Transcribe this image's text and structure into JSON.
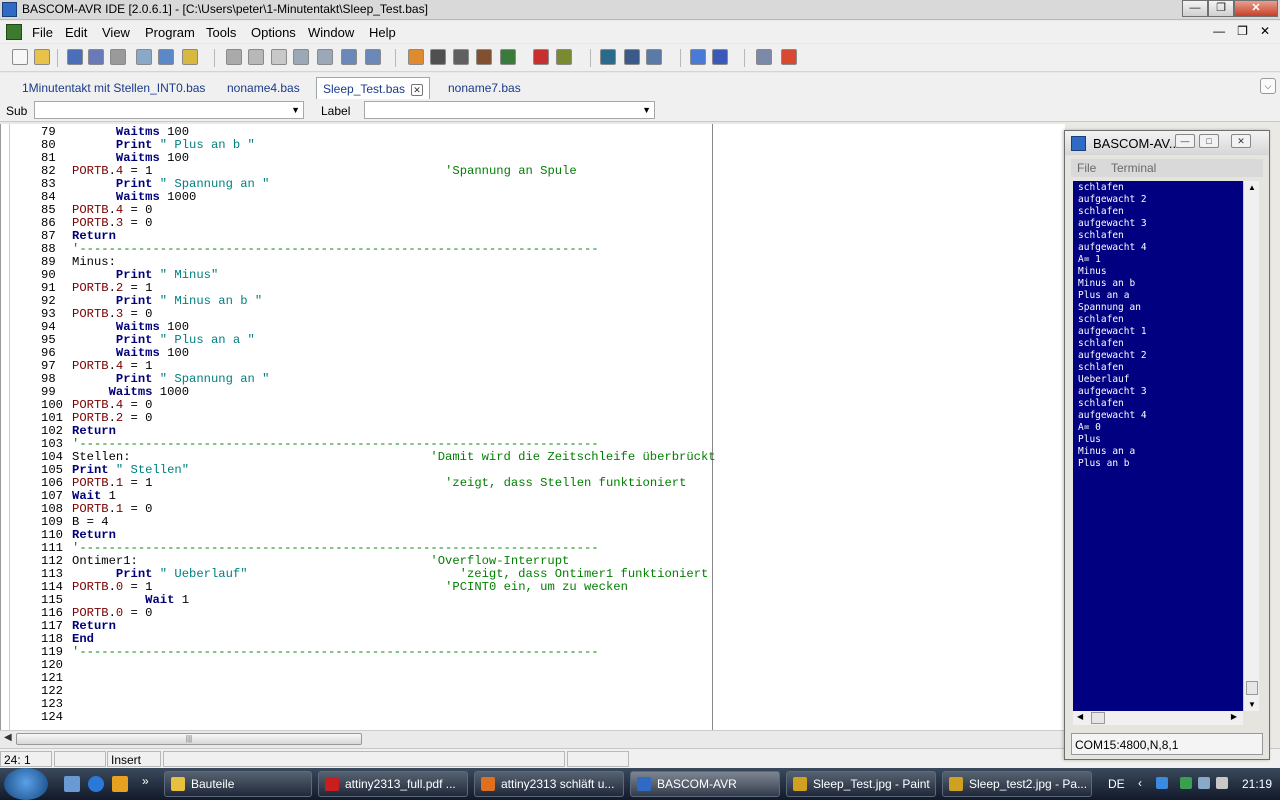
{
  "window": {
    "title": "BASCOM-AVR IDE [2.0.6.1] - [C:\\Users\\peter\\1-Minutentakt\\Sleep_Test.bas]"
  },
  "menu": [
    "File",
    "Edit",
    "View",
    "Program",
    "Tools",
    "Options",
    "Window",
    "Help"
  ],
  "toolbar": {
    "icons": [
      "new-file-icon",
      "open-file-icon",
      "save-icon",
      "save-all-icon",
      "print-icon",
      "print-preview-icon",
      "find-icon",
      "save-copy-icon",
      "cut-icon",
      "copy-icon",
      "paste-icon",
      "indent-icon",
      "unindent-icon",
      "find-text-icon",
      "replace-icon",
      "compile-icon",
      "syntax-check-icon",
      "chip-icon",
      "chip2-icon",
      "programmer-icon",
      "stop-icon",
      "lcd-icon",
      "simulator-icon",
      "terminal-icon",
      "wave-icon",
      "info-icon",
      "help-icon",
      "zoom-icon",
      "pdf-icon"
    ]
  },
  "tabs": [
    {
      "label": "1Minutentakt mit Stellen_INT0.bas",
      "active": false
    },
    {
      "label": "noname4.bas",
      "active": false
    },
    {
      "label": "Sleep_Test.bas",
      "active": true
    },
    {
      "label": "noname7.bas",
      "active": false
    }
  ],
  "combobar": {
    "sub_label": "Sub",
    "sub_value": "",
    "label_label": "Label",
    "label_value": ""
  },
  "code": [
    {
      "n": "79",
      "t": [
        [
          "i",
          "      "
        ],
        [
          "k",
          "Waitms"
        ],
        [
          "n",
          " 100"
        ]
      ]
    },
    {
      "n": "80",
      "t": [
        [
          "i",
          "      "
        ],
        [
          "k",
          "Print"
        ],
        [
          "s",
          " \" Plus an b \""
        ]
      ]
    },
    {
      "n": "81",
      "t": [
        [
          "i",
          "      "
        ],
        [
          "k",
          "Waitms"
        ],
        [
          "n",
          " 100"
        ]
      ]
    },
    {
      "n": "82",
      "t": [
        [
          "p",
          "PORTB"
        ],
        [
          "n",
          "."
        ],
        [
          "p",
          "4"
        ],
        [
          "n",
          " = 1"
        ],
        [
          "pad",
          "                                        "
        ],
        [
          "c",
          "'Spannung an Spule"
        ]
      ]
    },
    {
      "n": "83",
      "t": [
        [
          "i",
          "      "
        ],
        [
          "k",
          "Print"
        ],
        [
          "s",
          " \" Spannung an \""
        ]
      ]
    },
    {
      "n": "84",
      "t": [
        [
          "i",
          "      "
        ],
        [
          "k",
          "Waitms"
        ],
        [
          "n",
          " 1000"
        ]
      ]
    },
    {
      "n": "85",
      "t": [
        [
          "p",
          "PORTB"
        ],
        [
          "n",
          "."
        ],
        [
          "p",
          "4"
        ],
        [
          "n",
          " = 0"
        ]
      ]
    },
    {
      "n": "86",
      "t": [
        [
          "p",
          "PORTB"
        ],
        [
          "n",
          "."
        ],
        [
          "p",
          "3"
        ],
        [
          "n",
          " = 0"
        ]
      ]
    },
    {
      "n": "87",
      "t": [
        [
          "k",
          "Return"
        ]
      ]
    },
    {
      "n": "88",
      "t": [
        [
          "c",
          "'-----------------------------------------------------------------------"
        ]
      ]
    },
    {
      "n": "89",
      "t": [
        [
          "n",
          "Minus:"
        ]
      ]
    },
    {
      "n": "90",
      "t": [
        [
          "i",
          "      "
        ],
        [
          "k",
          "Print"
        ],
        [
          "s",
          " \" Minus\""
        ]
      ]
    },
    {
      "n": "91",
      "t": [
        [
          "p",
          "PORTB"
        ],
        [
          "n",
          "."
        ],
        [
          "p",
          "2"
        ],
        [
          "n",
          " = 1"
        ]
      ]
    },
    {
      "n": "92",
      "t": [
        [
          "i",
          "      "
        ],
        [
          "k",
          "Print"
        ],
        [
          "s",
          " \" Minus an b \""
        ]
      ]
    },
    {
      "n": "93",
      "t": [
        [
          "p",
          "PORTB"
        ],
        [
          "n",
          "."
        ],
        [
          "p",
          "3"
        ],
        [
          "n",
          " = 0"
        ]
      ]
    },
    {
      "n": "94",
      "t": [
        [
          "i",
          "      "
        ],
        [
          "k",
          "Waitms"
        ],
        [
          "n",
          " 100"
        ]
      ]
    },
    {
      "n": "95",
      "t": [
        [
          "i",
          "      "
        ],
        [
          "k",
          "Print"
        ],
        [
          "s",
          " \" Plus an a \""
        ]
      ]
    },
    {
      "n": "96",
      "t": [
        [
          "i",
          "      "
        ],
        [
          "k",
          "Waitms"
        ],
        [
          "n",
          " 100"
        ]
      ]
    },
    {
      "n": "97",
      "t": [
        [
          "p",
          "PORTB"
        ],
        [
          "n",
          "."
        ],
        [
          "p",
          "4"
        ],
        [
          "n",
          " = 1"
        ]
      ]
    },
    {
      "n": "98",
      "t": [
        [
          "i",
          "      "
        ],
        [
          "k",
          "Print"
        ],
        [
          "s",
          " \" Spannung an \""
        ]
      ]
    },
    {
      "n": "99",
      "t": [
        [
          "i",
          "     "
        ],
        [
          "k",
          "Waitms"
        ],
        [
          "n",
          " 1000"
        ]
      ]
    },
    {
      "n": "100",
      "t": [
        [
          "p",
          "PORTB"
        ],
        [
          "n",
          "."
        ],
        [
          "p",
          "4"
        ],
        [
          "n",
          " = 0"
        ]
      ]
    },
    {
      "n": "101",
      "t": [
        [
          "p",
          "PORTB"
        ],
        [
          "n",
          "."
        ],
        [
          "p",
          "2"
        ],
        [
          "n",
          " = 0"
        ]
      ]
    },
    {
      "n": "102",
      "t": [
        [
          "k",
          "Return"
        ]
      ]
    },
    {
      "n": "103",
      "t": [
        [
          "c",
          "'-----------------------------------------------------------------------"
        ]
      ]
    },
    {
      "n": "104",
      "t": [
        [
          "n",
          "Stellen:"
        ],
        [
          "pad",
          "                                         "
        ],
        [
          "c",
          "'Damit wird die Zeitschleife überbrückt"
        ]
      ]
    },
    {
      "n": "105",
      "t": [
        [
          "k",
          "Print"
        ],
        [
          "s",
          " \" Stellen\""
        ]
      ]
    },
    {
      "n": "106",
      "t": [
        [
          "p",
          "PORTB"
        ],
        [
          "n",
          "."
        ],
        [
          "p",
          "1"
        ],
        [
          "n",
          " = 1"
        ],
        [
          "pad",
          "                                        "
        ],
        [
          "c",
          "'zeigt, dass Stellen funktioniert"
        ]
      ]
    },
    {
      "n": "107",
      "t": [
        [
          "k",
          "Wait"
        ],
        [
          "n",
          " 1"
        ]
      ]
    },
    {
      "n": "108",
      "t": [
        [
          "p",
          "PORTB"
        ],
        [
          "n",
          "."
        ],
        [
          "p",
          "1"
        ],
        [
          "n",
          " = 0"
        ]
      ]
    },
    {
      "n": "109",
      "t": [
        [
          "n",
          "B = 4"
        ]
      ]
    },
    {
      "n": "110",
      "t": [
        [
          "k",
          "Return"
        ]
      ]
    },
    {
      "n": "111",
      "t": [
        [
          "c",
          "'-----------------------------------------------------------------------"
        ]
      ]
    },
    {
      "n": "112",
      "t": [
        [
          "n",
          "Ontimer1:"
        ],
        [
          "pad",
          "                                        "
        ],
        [
          "c",
          "'Overflow-Interrupt"
        ]
      ]
    },
    {
      "n": "113",
      "t": [
        [
          "i",
          "      "
        ],
        [
          "k",
          "Print"
        ],
        [
          "s",
          " \" Ueberlauf\""
        ],
        [
          "pad",
          "                             "
        ],
        [
          "c",
          "'zeigt, dass Ontimer1 funktioniert"
        ]
      ]
    },
    {
      "n": "114",
      "t": [
        [
          "p",
          "PORTB"
        ],
        [
          "n",
          "."
        ],
        [
          "p",
          "0"
        ],
        [
          "n",
          " = 1"
        ],
        [
          "pad",
          "                                        "
        ],
        [
          "c",
          "'PCINT0 ein, um zu wecken"
        ]
      ]
    },
    {
      "n": "115",
      "t": [
        [
          "i",
          "          "
        ],
        [
          "k",
          "Wait"
        ],
        [
          "n",
          " 1"
        ]
      ]
    },
    {
      "n": "116",
      "t": [
        [
          "p",
          "PORTB"
        ],
        [
          "n",
          "."
        ],
        [
          "p",
          "0"
        ],
        [
          "n",
          " = 0"
        ]
      ]
    },
    {
      "n": "117",
      "t": [
        [
          "k",
          "Return"
        ]
      ]
    },
    {
      "n": "118",
      "t": [
        [
          "k",
          "End"
        ]
      ]
    },
    {
      "n": "119",
      "t": [
        [
          "c",
          "'-----------------------------------------------------------------------"
        ]
      ]
    },
    {
      "n": "120",
      "t": []
    },
    {
      "n": "121",
      "t": []
    },
    {
      "n": "122",
      "t": []
    },
    {
      "n": "123",
      "t": []
    },
    {
      "n": "124",
      "t": []
    }
  ],
  "status": {
    "position": "24: 1",
    "mode": "Insert"
  },
  "terminal": {
    "title": "BASCOM-AV...",
    "menu": [
      "File",
      "Terminal"
    ],
    "lines": [
      "schlafen",
      "aufgewacht 2",
      "schlafen",
      "aufgewacht 3",
      "schlafen",
      "aufgewacht 4",
      "A= 1",
      "Minus",
      "Minus an b",
      "Plus an a",
      "Spannung an",
      "schlafen",
      "aufgewacht 1",
      "schlafen",
      "aufgewacht 2",
      "schlafen",
      "Ueberlauf",
      "aufgewacht 3",
      "schlafen",
      "aufgewacht 4",
      "A= 0",
      "Plus",
      "Minus an a",
      "Plus an b"
    ],
    "status": "COM15:4800,N,8,1"
  },
  "taskbar": {
    "items": [
      {
        "label": "Bauteile",
        "active": false,
        "color": "#e8c040"
      },
      {
        "label": "attiny2313_full.pdf ...",
        "active": false,
        "color": "#c81e1e"
      },
      {
        "label": "attiny2313 schläft u...",
        "active": false,
        "color": "#e07020"
      },
      {
        "label": "BASCOM-AVR",
        "active": true,
        "color": "#2f6bc4"
      },
      {
        "label": "Sleep_Test.jpg - Paint",
        "active": false,
        "color": "#d0a020"
      },
      {
        "label": "Sleep_test2.jpg - Pa...",
        "active": false,
        "color": "#d0a020"
      }
    ],
    "language": "DE",
    "clock": "21:19"
  }
}
